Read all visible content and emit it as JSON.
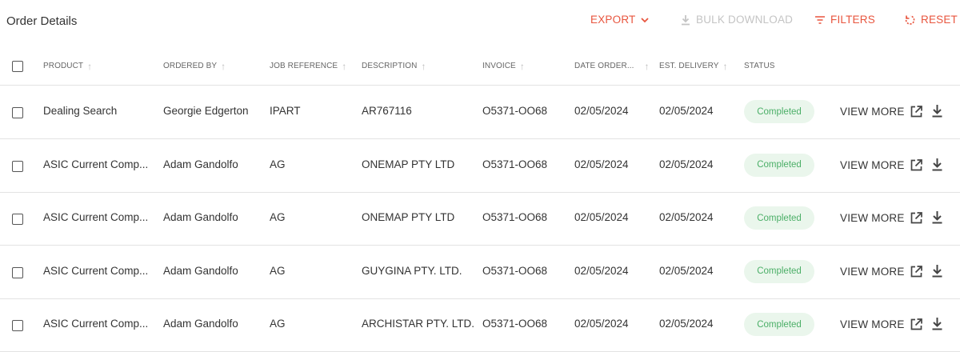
{
  "page_title": "Order Details",
  "toolbar": {
    "export_label": "EXPORT",
    "bulk_download_label": "BULK DOWNLOAD",
    "filters_label": "FILTERS",
    "reset_label": "RESET",
    "accent_color": "#e8553e",
    "disabled_color": "#c4c4c4"
  },
  "table": {
    "columns": {
      "product": "PRODUCT",
      "ordered_by": "ORDERED BY",
      "job_reference": "JOB REFERENCE",
      "description": "DESCRIPTION",
      "invoice": "INVOICE",
      "date_ordered": "DATE ORDER...",
      "est_delivery": "EST. DELIVERY",
      "status": "STATUS"
    },
    "rows": [
      {
        "product": "Dealing Search",
        "ordered_by": "Georgie Edgerton",
        "job_reference": "IPART",
        "description": "AR767116",
        "invoice": "O5371-OO68",
        "date_ordered": "02/05/2024",
        "est_delivery": "02/05/2024",
        "status": "Completed",
        "action": "VIEW MORE"
      },
      {
        "product": "ASIC Current Comp...",
        "ordered_by": "Adam Gandolfo",
        "job_reference": "AG",
        "description": "ONEMAP PTY LTD",
        "invoice": "O5371-OO68",
        "date_ordered": "02/05/2024",
        "est_delivery": "02/05/2024",
        "status": "Completed",
        "action": "VIEW MORE"
      },
      {
        "product": "ASIC Current Comp...",
        "ordered_by": "Adam Gandolfo",
        "job_reference": "AG",
        "description": "ONEMAP PTY LTD",
        "invoice": "O5371-OO68",
        "date_ordered": "02/05/2024",
        "est_delivery": "02/05/2024",
        "status": "Completed",
        "action": "VIEW MORE"
      },
      {
        "product": "ASIC Current Comp...",
        "ordered_by": "Adam Gandolfo",
        "job_reference": "AG",
        "description": "GUYGINA PTY. LTD.",
        "invoice": "O5371-OO68",
        "date_ordered": "02/05/2024",
        "est_delivery": "02/05/2024",
        "status": "Completed",
        "action": "VIEW MORE"
      },
      {
        "product": "ASIC Current Comp...",
        "ordered_by": "Adam Gandolfo",
        "job_reference": "AG",
        "description": "ARCHISTAR PTY. LTD.",
        "invoice": "O5371-OO68",
        "date_ordered": "02/05/2024",
        "est_delivery": "02/05/2024",
        "status": "Completed",
        "action": "VIEW MORE"
      }
    ],
    "status_colors": {
      "completed_bg": "#eaf6ec",
      "completed_text": "#4caf68"
    }
  },
  "icons": {
    "export": "chevron-down-icon",
    "bulk_download": "download-icon",
    "filters": "filter-icon",
    "reset": "reset-icon",
    "sort": "sort-arrow-up-icon",
    "open": "open-in-new-icon",
    "download": "download-icon"
  }
}
